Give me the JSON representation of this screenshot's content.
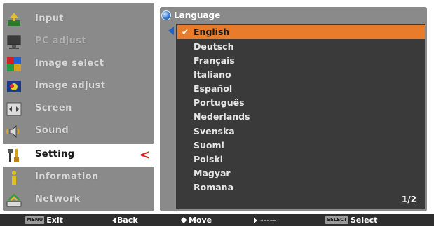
{
  "sidebar": {
    "items": [
      {
        "label": "Input",
        "icon": "input-icon"
      },
      {
        "label": "PC adjust",
        "icon": "pc-adjust-icon"
      },
      {
        "label": "Image select",
        "icon": "image-select-icon"
      },
      {
        "label": "Image adjust",
        "icon": "image-adjust-icon"
      },
      {
        "label": "Screen",
        "icon": "screen-icon"
      },
      {
        "label": "Sound",
        "icon": "sound-icon"
      },
      {
        "label": "Setting",
        "icon": "setting-icon"
      },
      {
        "label": "Information",
        "icon": "information-icon"
      },
      {
        "label": "Network",
        "icon": "network-icon"
      }
    ],
    "active_chevron": "<"
  },
  "panel": {
    "title": "Language",
    "languages": [
      "English",
      "Deutsch",
      "Français",
      "Italiano",
      "Español",
      "Português",
      "Nederlands",
      "Svenska",
      "Suomi",
      "Polski",
      "Magyar",
      "Romana"
    ],
    "check_mark": "✔",
    "page": "1/2"
  },
  "bottom_bar": {
    "exit_key": "MENU",
    "exit_label": "Exit",
    "back_label": "Back",
    "move_label": "Move",
    "right_label": "-----",
    "select_key": "SELECT",
    "select_label": "Select"
  },
  "colors": {
    "highlight": "#e87c2a",
    "active_chevron": "#e0201a",
    "panel_bg": "#8a8a8a",
    "list_bg": "#3a3a3a"
  }
}
